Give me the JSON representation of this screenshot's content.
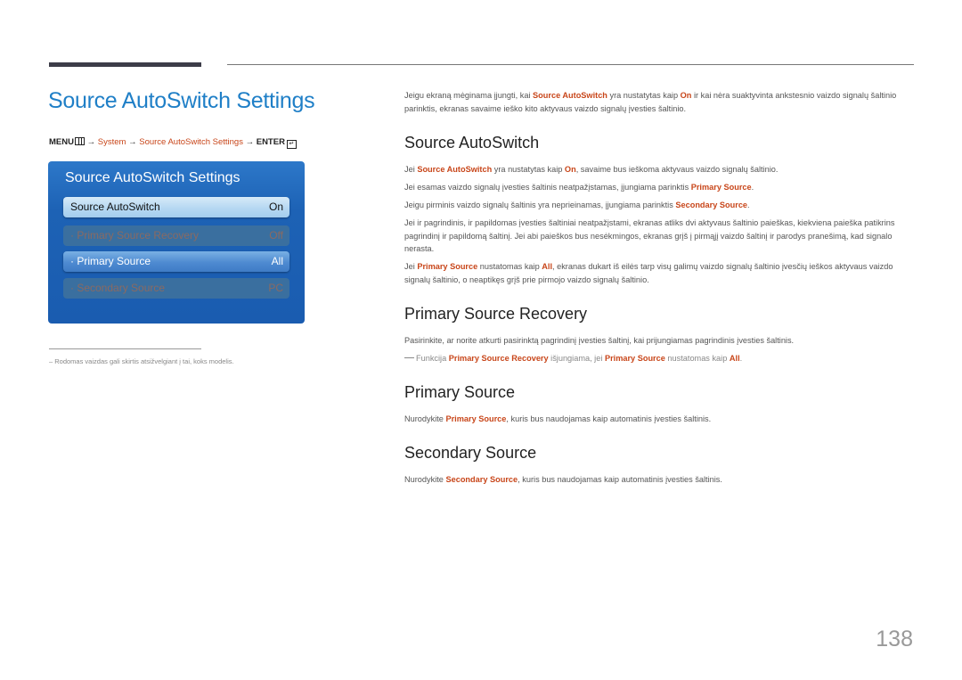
{
  "page": {
    "title": "Source AutoSwitch Settings",
    "page_number": "138"
  },
  "menu_path": {
    "menu": "MENU",
    "arrow": "→",
    "system": "System",
    "settings": "Source AutoSwitch Settings",
    "enter": "ENTER",
    "enter_glyph": "↵"
  },
  "osd": {
    "title": "Source AutoSwitch Settings",
    "items": [
      {
        "label": "Source AutoSwitch",
        "value": "On",
        "state": "selected"
      },
      {
        "label": "· Primary Source Recovery",
        "value": "Off",
        "state": "disabled"
      },
      {
        "label": "· Primary Source",
        "value": "All",
        "state": "active"
      },
      {
        "label": "· Secondary Source",
        "value": "PC",
        "state": "disabled"
      }
    ]
  },
  "footnote": "–  Rodomas vaizdas gali skirtis atsižvelgiant į tai, koks modelis.",
  "intro": {
    "t1": "Jeigu ekraną mėginama įjungti, kai ",
    "h1": "Source AutoSwitch",
    "t2": " yra nustatytas kaip ",
    "h2": "On",
    "t3": " ir kai nėra suaktyvinta ankstesnio vaizdo signalų šaltinio parinktis, ekranas savaime ieško kito aktyvaus vaizdo signalų įvesties šaltinio."
  },
  "sections": {
    "autoswitch": {
      "heading": "Source AutoSwitch",
      "p1": {
        "t1": "Jei ",
        "h1": "Source AutoSwitch",
        "t2": " yra nustatytas kaip ",
        "h2": "On",
        "t3": ", savaime bus ieškoma aktyvaus vaizdo signalų šaltinio."
      },
      "p2": {
        "t1": "Jei esamas vaizdo signalų įvesties šaltinis neatpažįstamas, įjungiama parinktis ",
        "h1": "Primary Source",
        "t2": "."
      },
      "p3": {
        "t1": "Jeigu pirminis vaizdo signalų šaltinis yra neprieinamas, įjungiama parinktis ",
        "h1": "Secondary Source",
        "t2": "."
      },
      "p4": "Jei ir pagrindinis, ir papildomas įvesties šaltiniai neatpažįstami, ekranas atliks dvi aktyvaus šaltinio paieškas, kiekviena paieška patikrins pagrindinį ir papildomą šaltinį. Jei abi paieškos bus nesėkmingos, ekranas grįš į pirmąjį vaizdo šaltinį ir parodys pranešimą, kad signalo nerasta.",
      "p5": {
        "t1": "Jei ",
        "h1": "Primary Source",
        "t2": " nustatomas kaip ",
        "h2": "All",
        "t3": ", ekranas dukart iš eilės tarp visų galimų vaizdo signalų šaltinio įvesčių ieškos aktyvaus vaizdo signalų šaltinio, o neaptikęs grįš prie pirmojo vaizdo signalų šaltinio."
      }
    },
    "recovery": {
      "heading": "Primary Source Recovery",
      "p1": "Pasirinkite, ar norite atkurti pasirinktą pagrindinį įvesties šaltinį, kai prijungiamas pagrindinis įvesties šaltinis.",
      "note": {
        "t1": "Funkcija ",
        "h1": "Primary Source Recovery",
        "t2": " išjungiama, jei ",
        "h2": "Primary Source",
        "t3": " nustatomas kaip ",
        "h3": "All",
        "t4": "."
      }
    },
    "primary": {
      "heading": "Primary Source",
      "p1": {
        "t1": "Nurodykite ",
        "h1": "Primary Source",
        "t2": ", kuris bus naudojamas kaip automatinis įvesties šaltinis."
      }
    },
    "secondary": {
      "heading": "Secondary Source",
      "p1": {
        "t1": "Nurodykite ",
        "h1": "Secondary Source",
        "t2": ", kuris bus naudojamas kaip automatinis įvesties šaltinis."
      }
    }
  }
}
